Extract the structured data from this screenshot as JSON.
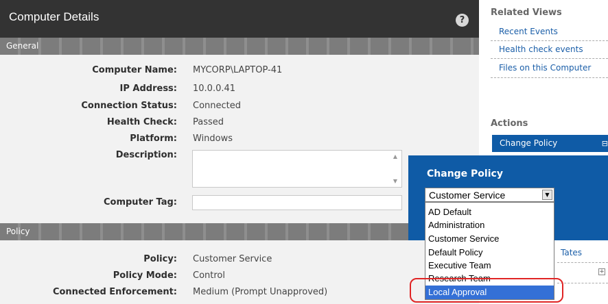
{
  "window": {
    "title": "Computer Details",
    "help_icon": "?"
  },
  "general": {
    "section_label": "General",
    "fields": [
      {
        "label": "Computer Name:",
        "value": "MYCORP\\LAPTOP-41"
      },
      {
        "label": "IP Address:",
        "value": "10.0.0.41"
      },
      {
        "label": "Connection Status:",
        "value": "Connected"
      },
      {
        "label": "Health Check:",
        "value": "Passed"
      },
      {
        "label": "Platform:",
        "value": "Windows"
      }
    ],
    "description_label": "Description:",
    "description_value": "",
    "computer_tag_label": "Computer Tag:",
    "computer_tag_value": ""
  },
  "policy": {
    "section_label": "Policy",
    "fields": [
      {
        "label": "Policy:",
        "value": "Customer Service"
      },
      {
        "label": "Policy Mode:",
        "value": "Control"
      },
      {
        "label": "Connected Enforcement:",
        "value": "Medium (Prompt Unapproved)"
      }
    ]
  },
  "sidebar": {
    "related_heading": "Related Views",
    "related_links": [
      "Recent Events",
      "Health check events",
      "Files on this Computer"
    ],
    "actions_heading": "Actions",
    "action_item": "Change Policy",
    "partially_hidden_link": "Tates"
  },
  "change_policy": {
    "title": "Change Policy",
    "selected_value": "Customer Service",
    "options": [
      "AD Default",
      "Administration",
      "Customer Service",
      "Default Policy",
      "Executive Team",
      "Research Team",
      "Local Approval"
    ],
    "highlighted_option": "Local Approval"
  },
  "colors": {
    "title_bar": "#333333",
    "accent_blue": "#0f5ba6",
    "selection": "#3470d6",
    "annotation_ring": "#e02424"
  }
}
